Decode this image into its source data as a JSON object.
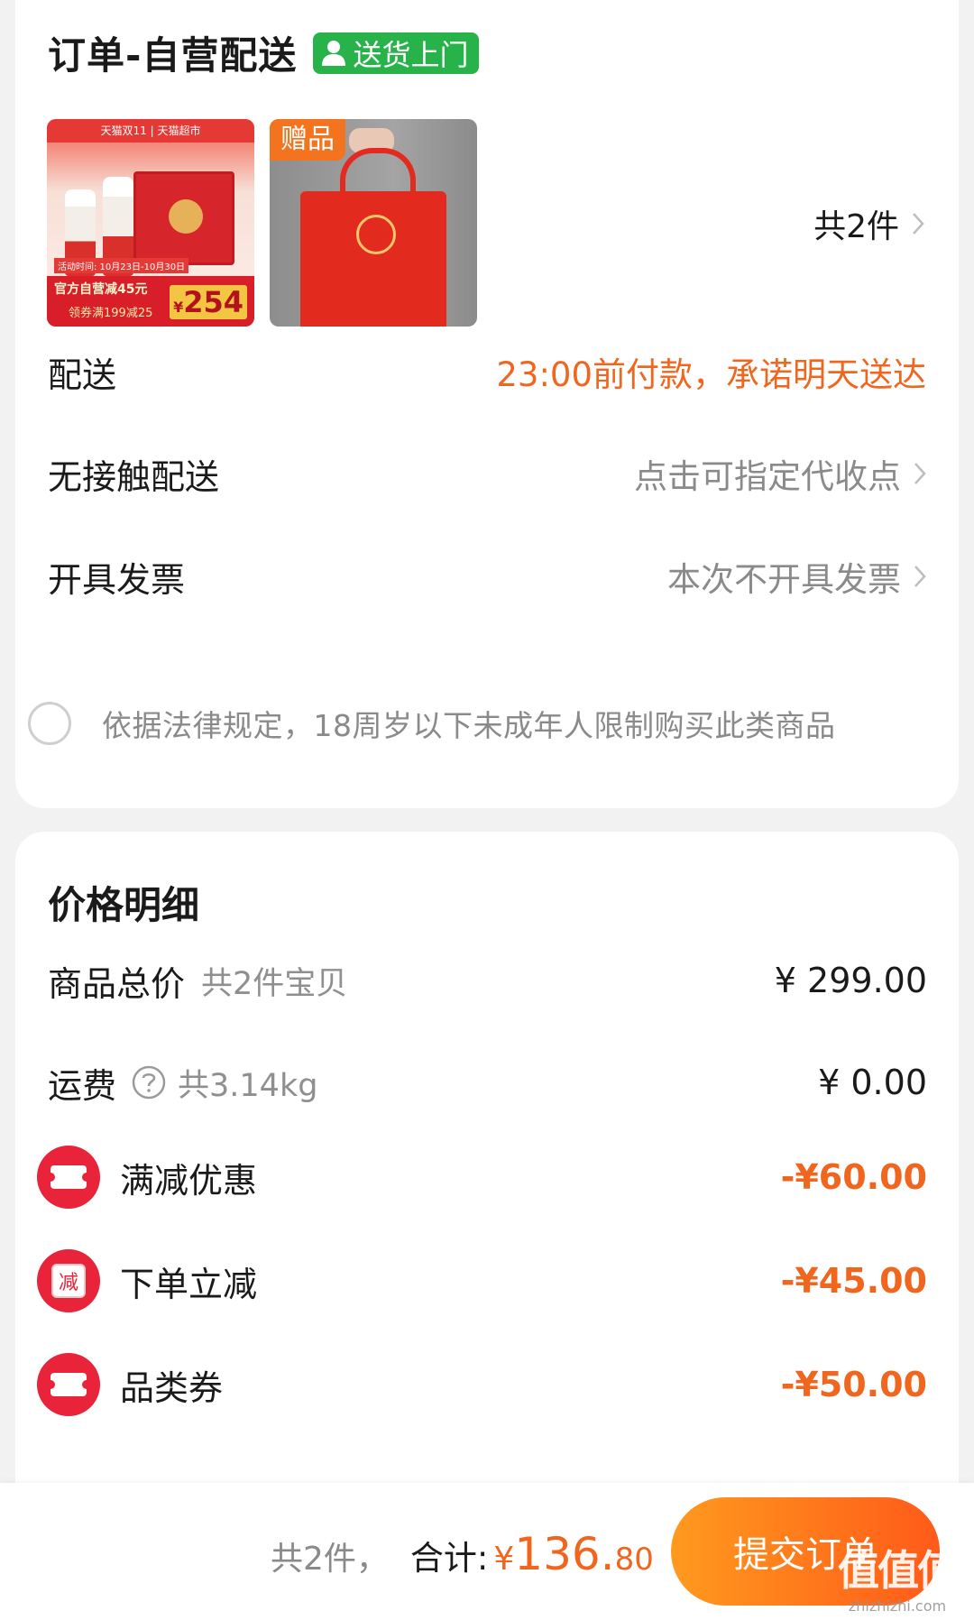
{
  "order": {
    "title": "订单-自营配送",
    "badge": "送货上门",
    "thumb1": {
      "banner": "天猫双11 | 天猫超市",
      "date": "活动时间: 10月23日-10月30日",
      "line1": "官方自营减45元",
      "line2": "领券满199减25",
      "currency": "¥",
      "price": "254"
    },
    "thumb2": {
      "tag": "赠品"
    },
    "count": "共2件",
    "delivery_label": "配送",
    "delivery_value": "23:00前付款，承诺明天送达",
    "contactless_label": "无接触配送",
    "contactless_value": "点击可指定代收点",
    "invoice_label": "开具发票",
    "invoice_value": "本次不开具发票",
    "age_notice": "依据法律规定，18周岁以下未成年人限制购买此类商品"
  },
  "price": {
    "title": "价格明细",
    "goods_label": "商品总价",
    "goods_sub": "共2件宝贝",
    "goods_amount": "¥ 299.00",
    "shipping_label": "运费",
    "shipping_sub": "共3.14kg",
    "shipping_amount": "¥ 0.00",
    "discounts": [
      {
        "label": "满减优惠",
        "amount": "-¥60.00",
        "icon": "ticket-icon"
      },
      {
        "label": "下单立减",
        "amount": "-¥45.00",
        "icon": "jian-icon",
        "glyph": "减"
      },
      {
        "label": "品类券",
        "amount": "-¥50.00",
        "icon": "ticket-icon"
      }
    ]
  },
  "footer": {
    "count": "共2件，",
    "total_label": "合计:",
    "currency": "¥",
    "total_int": "136.",
    "total_dec": "80",
    "submit": "提交订单"
  },
  "watermark": {
    "mark": "值值值",
    "url": "zhizhizhi.com"
  },
  "colors": {
    "accent": "#f0661e",
    "badge": "#27b34a",
    "discount": "#e8233a"
  }
}
